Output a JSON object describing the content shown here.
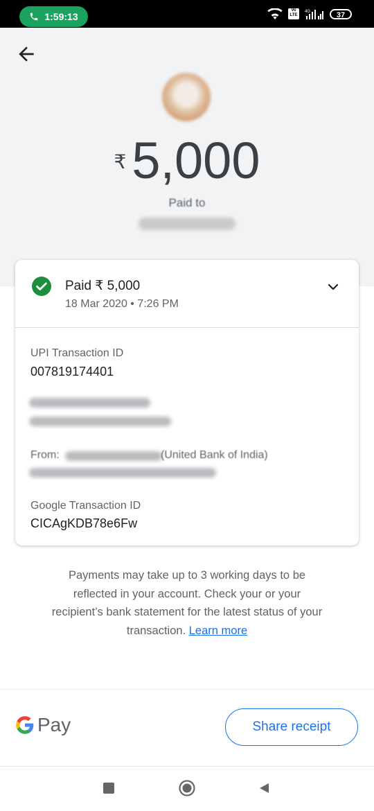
{
  "status_bar": {
    "call_time": "1:59:13",
    "volte_label": "Vo LTE",
    "network": "4G",
    "battery": "37"
  },
  "header": {
    "currency_symbol": "₹",
    "amount": "5,000",
    "paid_to_label": "Paid to"
  },
  "card": {
    "status_title": "Paid ₹ 5,000",
    "status_date": "18 Mar 2020 • 7:26 PM",
    "upi_label": "UPI Transaction ID",
    "upi_value": "007819174401",
    "from_prefix": "From:",
    "from_bank": "(United Bank of India)",
    "google_label": "Google Transaction ID",
    "google_value": "CICAgKDB78e6Fw"
  },
  "note": {
    "text": "Payments may take up to 3 working days to be reflected in your account. Check your or your recipient’s bank statement for the latest status of your transaction.",
    "learn_more": "Learn more"
  },
  "footer": {
    "brand_text": "Pay",
    "share_label": "Share receipt"
  },
  "colors": {
    "accent": "#1a73e8",
    "success": "#1e8e3e",
    "call_pill": "#1aa260"
  },
  "icons": [
    "back-arrow-icon",
    "check-circle-icon",
    "chevron-down-icon",
    "google-g-icon"
  ]
}
